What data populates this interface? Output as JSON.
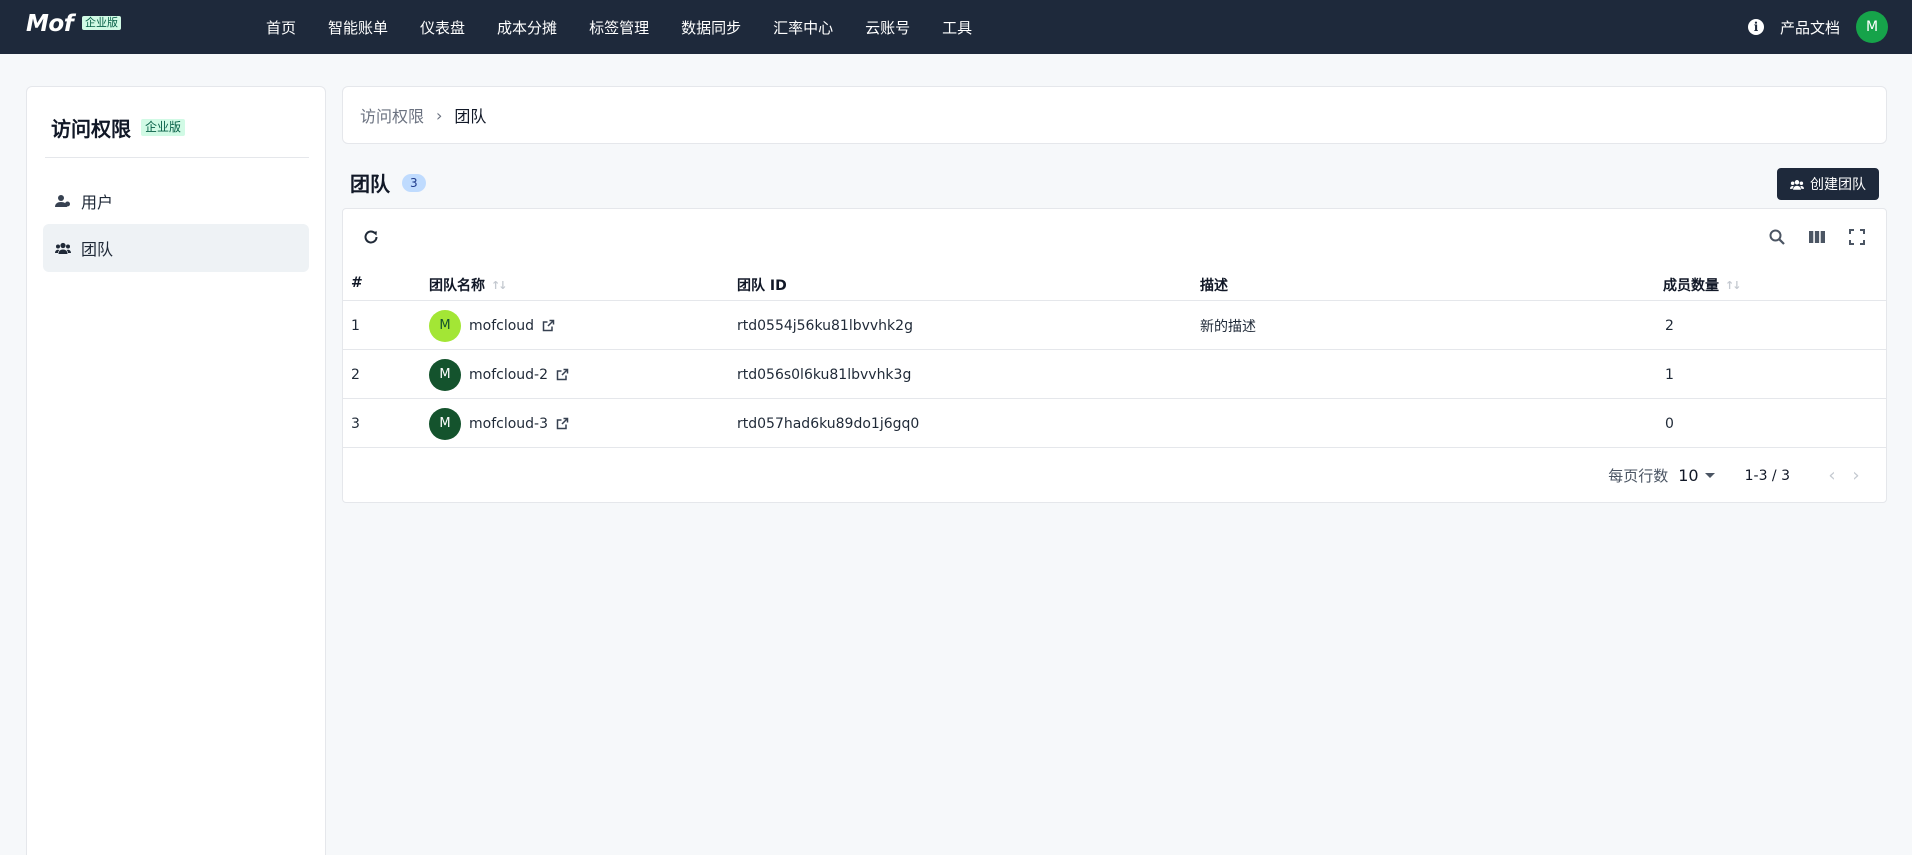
{
  "header": {
    "logo": "Mof",
    "logo_badge": "企业版",
    "nav": [
      "首页",
      "智能账单",
      "仪表盘",
      "成本分摊",
      "标签管理",
      "数据同步",
      "汇率中心",
      "云账号",
      "工具"
    ],
    "docs": "产品文档",
    "avatar_letter": "M",
    "info_icon": "info-icon"
  },
  "sidebar": {
    "title": "访问权限",
    "badge": "企业版",
    "items": [
      {
        "label": "用户",
        "icon": "user-icon",
        "active": false
      },
      {
        "label": "团队",
        "icon": "team-icon",
        "active": true
      }
    ]
  },
  "breadcrumb": {
    "root": "访问权限",
    "separator": "›",
    "current": "团队"
  },
  "page": {
    "title": "团队",
    "count": "3",
    "create_label": "创建团队"
  },
  "table": {
    "columns": [
      "#",
      "团队名称",
      "团队 ID",
      "描述",
      "成员数量"
    ],
    "rows": [
      {
        "index": "1",
        "letter": "M",
        "name": "mofcloud",
        "id": "rtd0554j56ku81lbvvhk2g",
        "desc": "新的描述",
        "members": "2",
        "avatar_color": "#a3e635",
        "avatar_text": "#14532d"
      },
      {
        "index": "2",
        "letter": "M",
        "name": "mofcloud-2",
        "id": "rtd056s0l6ku81lbvvhk3g",
        "desc": "",
        "members": "1",
        "avatar_color": "#14532d",
        "avatar_text": "#ffffff"
      },
      {
        "index": "3",
        "letter": "M",
        "name": "mofcloud-3",
        "id": "rtd057had6ku89do1j6gq0",
        "desc": "",
        "members": "0",
        "avatar_color": "#14532d",
        "avatar_text": "#ffffff"
      }
    ]
  },
  "pagination": {
    "rows_label": "每页行数",
    "rows_value": "10",
    "range": "1-3 / 3",
    "prev": "‹",
    "next": "›"
  },
  "colors": {
    "topbar": "#1e293b",
    "accent_green": "#16a34a"
  }
}
